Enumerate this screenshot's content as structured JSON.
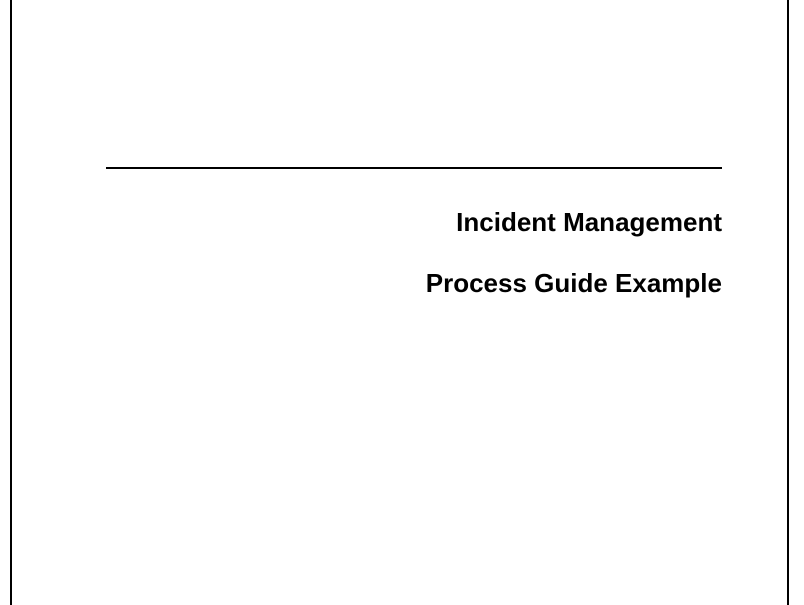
{
  "document": {
    "title_line_1": "Incident Management",
    "title_line_2": "Process Guide Example"
  }
}
